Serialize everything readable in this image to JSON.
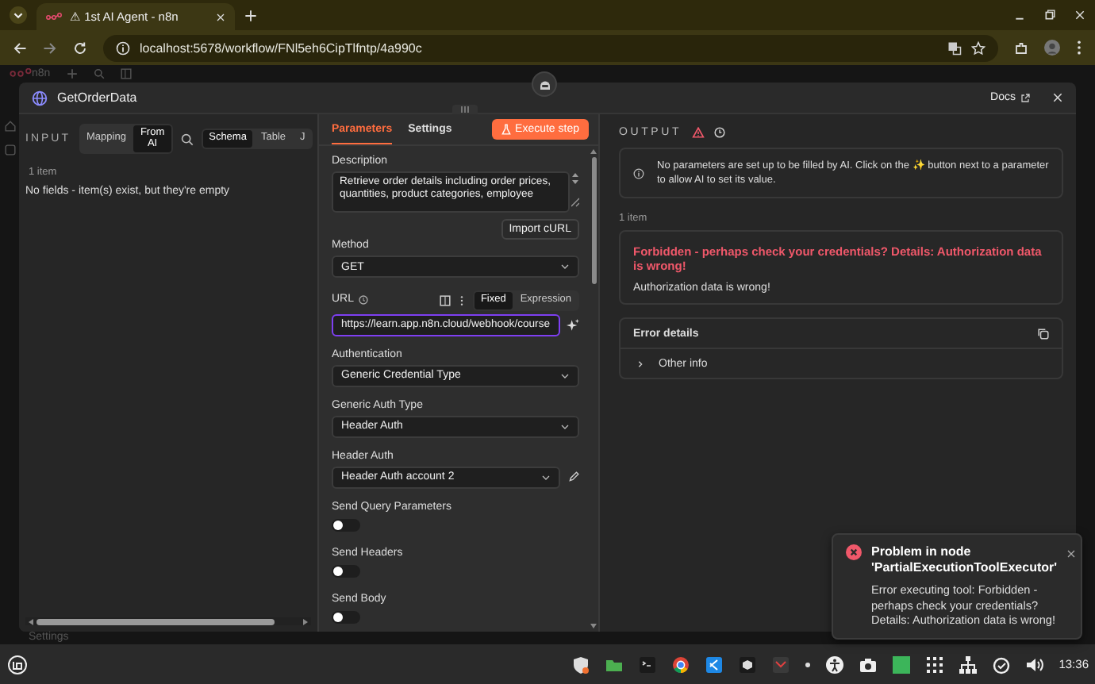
{
  "browser": {
    "tab_title": "⚠ 1st AI Agent - n8n",
    "url": "localhost:5678/workflow/FNl5eh6CipTlfntp/4a990c"
  },
  "app": {
    "logo": "n8n",
    "sidebar_item": "Settings"
  },
  "node": {
    "title": "GetOrderData",
    "docs": "Docs"
  },
  "input": {
    "label": "INPUT",
    "modes": [
      {
        "label": "Mapping",
        "selected": false
      },
      {
        "label": "From AI",
        "selected": true
      }
    ],
    "views": [
      {
        "label": "Schema",
        "selected": true
      },
      {
        "label": "Table",
        "selected": false
      },
      {
        "label": "J",
        "selected": false
      }
    ],
    "count": "1 item",
    "message": "No fields - item(s) exist, but they're empty"
  },
  "parameters": {
    "tabs": [
      {
        "label": "Parameters",
        "selected": true
      },
      {
        "label": "Settings",
        "selected": false
      }
    ],
    "execute": "Execute step",
    "fields": [
      {
        "kind": "textarea",
        "label": "Description",
        "value": "Retrieve order details including order prices, quantities, product categories, employee"
      },
      {
        "kind": "button",
        "label": "Import cURL"
      },
      {
        "kind": "select",
        "label": "Method",
        "value": "GET"
      },
      {
        "kind": "url",
        "label": "URL",
        "modes": [
          {
            "label": "Fixed",
            "selected": true
          },
          {
            "label": "Expression",
            "selected": false
          }
        ],
        "value": "https://learn.app.n8n.cloud/webhook/course"
      },
      {
        "kind": "select",
        "label": "Authentication",
        "value": "Generic Credential Type"
      },
      {
        "kind": "select",
        "label": "Generic Auth Type",
        "value": "Header Auth"
      },
      {
        "kind": "credential",
        "label": "Header Auth",
        "value": "Header Auth account 2"
      },
      {
        "kind": "toggle",
        "label": "Send Query Parameters",
        "on": false
      },
      {
        "kind": "toggle",
        "label": "Send Headers",
        "on": false
      },
      {
        "kind": "toggle",
        "label": "Send Body",
        "on": false
      }
    ]
  },
  "output": {
    "label": "OUTPUT",
    "notice": "No parameters are set up to be filled by AI. Click on the ✨ button next to a parameter to allow AI to set its value.",
    "count": "1 item",
    "error_title": "Forbidden - perhaps check your credentials? Details: Authorization data is wrong!",
    "error_message": "Authorization data is wrong!",
    "details_title": "Error details",
    "details_items": [
      {
        "label": "Other info",
        "expanded": false
      }
    ]
  },
  "toast": {
    "title": "Problem in node 'PartialExecutionToolExecutor'",
    "message": "Error executing tool: Forbidden - perhaps check your credentials? Details: Authorization data is wrong!"
  },
  "taskbar": {
    "clock": "13:36"
  }
}
